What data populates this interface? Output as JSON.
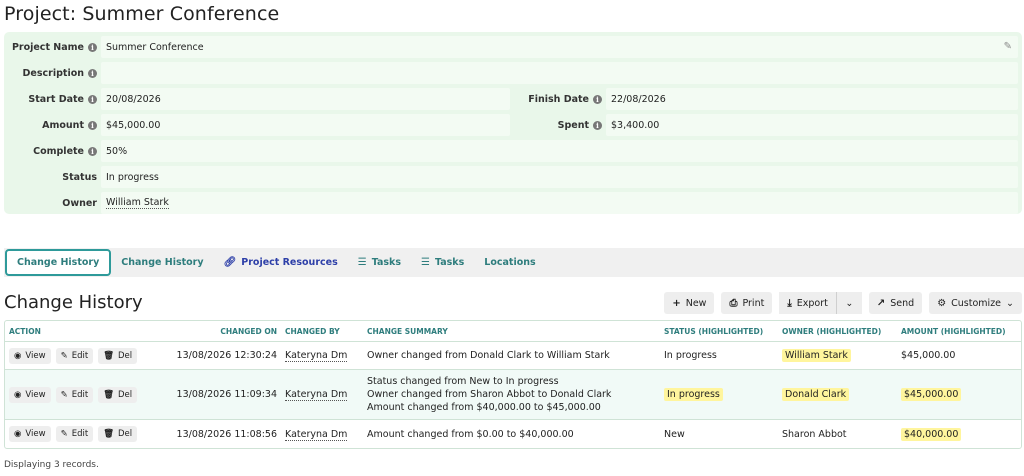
{
  "page": {
    "title": "Project: Summer Conference"
  },
  "details": {
    "project_name": {
      "label": "Project Name",
      "value": "Summer Conference"
    },
    "description": {
      "label": "Description",
      "value": ""
    },
    "start_date": {
      "label": "Start Date",
      "value": "20/08/2026"
    },
    "finish_date": {
      "label": "Finish Date",
      "value": "22/08/2026"
    },
    "amount": {
      "label": "Amount",
      "value": "$45,000.00"
    },
    "spent": {
      "label": "Spent",
      "value": "$3,400.00"
    },
    "complete": {
      "label": "Complete",
      "value": "50%"
    },
    "status": {
      "label": "Status",
      "value": "In progress"
    },
    "owner": {
      "label": "Owner",
      "value": "William Stark"
    },
    "info_glyph": "i",
    "edit_icon": "pencil-icon"
  },
  "tabs": [
    {
      "label": "Change History",
      "icon": ""
    },
    {
      "label": "Change History",
      "icon": ""
    },
    {
      "label": "Project Resources",
      "icon": "link-icon"
    },
    {
      "label": "Tasks",
      "icon": "checklist-icon"
    },
    {
      "label": "Tasks",
      "icon": "checklist-icon"
    },
    {
      "label": "Locations",
      "icon": ""
    }
  ],
  "section": {
    "title": "Change History"
  },
  "toolbar": {
    "new_label": "New",
    "print_label": "Print",
    "export_label": "Export",
    "send_label": "Send",
    "customize_label": "Customize"
  },
  "grid": {
    "columns": {
      "action": "Action",
      "changed_on": "Changed On",
      "changed_by": "Changed By",
      "summary": "Change Summary",
      "status": "Status (Highlighted)",
      "owner": "Owner (Highlighted)",
      "amount": "Amount (Highlighted)"
    },
    "action_labels": {
      "view": "View",
      "edit": "Edit",
      "del": "Del"
    },
    "rows": [
      {
        "changed_on": "13/08/2026 12:30:24",
        "changed_by": "Kateryna Dm",
        "summary": [
          "Owner changed from Donald Clark to William Stark"
        ],
        "status": "In progress",
        "owner": "William Stark",
        "amount": "$45,000.00"
      },
      {
        "changed_on": "13/08/2026 11:09:34",
        "changed_by": "Kateryna Dm",
        "summary": [
          "Status changed from New to In progress",
          "Owner changed from Sharon Abbot to Donald Clark",
          "Amount changed from $40,000.00 to $45,000.00"
        ],
        "status": "In progress",
        "owner": "Donald Clark",
        "amount": "$45,000.00"
      },
      {
        "changed_on": "13/08/2026 11:08:56",
        "changed_by": "Kateryna Dm",
        "summary": [
          "Amount changed from $0.00 to $40,000.00"
        ],
        "status": "New",
        "owner": "Sharon Abbot",
        "amount": "$40,000.00"
      }
    ]
  },
  "footer": {
    "text": "Displaying 3 records."
  }
}
